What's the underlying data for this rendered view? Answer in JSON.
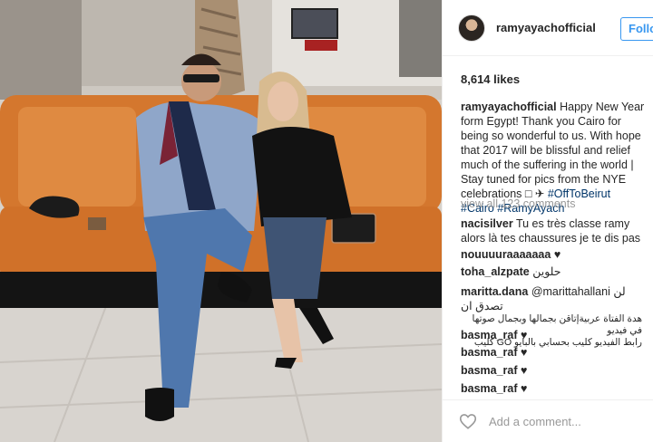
{
  "post": {
    "username": "ramyayachofficial",
    "follow_label": "Follow",
    "likes": "8,614 likes",
    "caption": {
      "username": "ramyayachofficial",
      "text": "Happy New Year form Egypt! Thank you Cairo for being so wonderful to us. With hope that 2017 will be blissful and relief much of the suffering in the world | Stay tuned for pics from the NYE celebrations □ ✈",
      "hashtags": "#OffToBeirut #Cairo #RamyAyach"
    },
    "view_all": "view all 123 comments",
    "comments": [
      {
        "user": "nacisilver",
        "text": "Tu es très classe ramy alors là tes chaussures je te dis pas"
      },
      {
        "user": "nouuuuraaaaaaa",
        "text": "♥"
      },
      {
        "user": "toha_alzpate",
        "text": "حلوين"
      },
      {
        "user": "maritta.dana",
        "text": "@marittahallani لن تصدق ان",
        "extra": "هدة الفتاة عربيةإتاقن بجمالها وبجمال صوتها في فيديو",
        "extra2": "رابط الفيديو كليب بحسابي بالبايو GO كليب"
      },
      {
        "user": "basma_raf",
        "text": "♥"
      },
      {
        "user": "basma_raf",
        "text": "♥"
      },
      {
        "user": "basma_raf",
        "text": "♥"
      },
      {
        "user": "basma_raf",
        "text": "♥"
      }
    ],
    "add_comment_placeholder": "Add a comment..."
  },
  "colors": {
    "link": "#003569",
    "accent": "#3897f0",
    "muted": "#999999",
    "sofa": "#d4772e"
  },
  "icons": {
    "like": "heart-icon"
  }
}
